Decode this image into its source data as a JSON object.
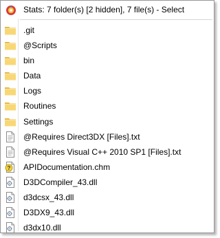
{
  "header": {
    "icon": "shell-menu-icon",
    "text": "Stats: 7 folder(s) [2 hidden], 7 file(s) - Select"
  },
  "colors": {
    "folder": "#f8d775",
    "folder_dark": "#e6b748",
    "border": "#979797",
    "separator": "#d7d7d7"
  },
  "items": [
    {
      "label": ".git",
      "icon": "folder-icon",
      "type": "folder"
    },
    {
      "label": "@Scripts",
      "icon": "folder-icon",
      "type": "folder"
    },
    {
      "label": "bin",
      "icon": "folder-icon",
      "type": "folder"
    },
    {
      "label": "Data",
      "icon": "folder-icon",
      "type": "folder"
    },
    {
      "label": "Logs",
      "icon": "folder-icon",
      "type": "folder"
    },
    {
      "label": "Routines",
      "icon": "folder-icon",
      "type": "folder"
    },
    {
      "label": "Settings",
      "icon": "folder-icon",
      "type": "folder"
    },
    {
      "label": "@Requires Direct3DX [Files].txt",
      "icon": "text-file-icon",
      "type": "txt"
    },
    {
      "label": "@Requires Visual C++ 2010 SP1 [Files].txt",
      "icon": "text-file-icon",
      "type": "txt"
    },
    {
      "label": "APIDocumentation.chm",
      "icon": "help-file-icon",
      "type": "chm"
    },
    {
      "label": "D3DCompiler_43.dll",
      "icon": "dll-file-icon",
      "type": "dll"
    },
    {
      "label": "d3dcsx_43.dll",
      "icon": "dll-file-icon",
      "type": "dll"
    },
    {
      "label": "D3DX9_43.dll",
      "icon": "dll-file-icon",
      "type": "dll"
    },
    {
      "label": "d3dx10.dll",
      "icon": "dll-file-icon",
      "type": "dll"
    }
  ]
}
